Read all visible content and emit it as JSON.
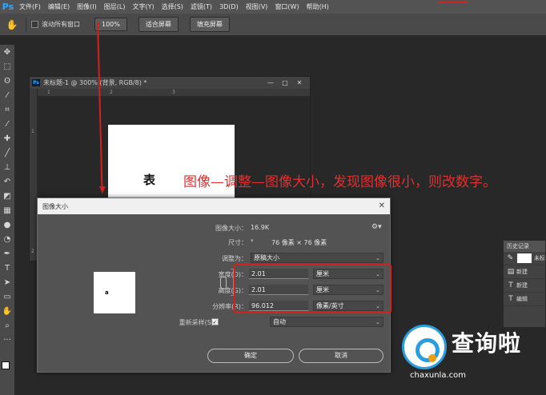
{
  "app": {
    "logo": "Ps"
  },
  "menubar": {
    "items": [
      "文件(F)",
      "编辑(E)",
      "图像(I)",
      "图层(L)",
      "文字(Y)",
      "选择(S)",
      "滤镜(T)",
      "3D(D)",
      "视图(V)",
      "窗口(W)",
      "帮助(H)"
    ]
  },
  "options_bar": {
    "tool_icon": "hand-icon",
    "scroll_all_label": "滚动所有窗口",
    "zoom_100_label": "100%",
    "fit_screen_label": "适合屏幕",
    "fill_screen_label": "填充屏幕"
  },
  "toolbar": {
    "tools": [
      "move-icon",
      "marquee-icon",
      "lasso-icon",
      "quick-select-icon",
      "crop-icon",
      "eyedropper-icon",
      "healing-icon",
      "brush-icon",
      "stamp-icon",
      "history-brush-icon",
      "eraser-icon",
      "gradient-icon",
      "blur-icon",
      "dodge-icon",
      "pen-icon",
      "type-icon",
      "path-select-icon",
      "rectangle-icon",
      "hand-icon",
      "zoom-icon",
      "more-icon"
    ]
  },
  "document": {
    "title": "未标题-1 @ 300% (背景, RGB/8) *",
    "ruler_h": [
      "1",
      "2",
      "3"
    ],
    "ruler_v": [
      "1",
      "2"
    ],
    "canvas_char": "表"
  },
  "annotation": {
    "text": "图像—调整—图像大小，发现图像很小，则改数字。",
    "color": "#e03030"
  },
  "dialog": {
    "title": "图像大小",
    "preview_char": "a",
    "image_size_label": "图像大小：",
    "image_size_value": "16.9K",
    "dimensions_label": "尺寸：",
    "dimensions_value": "76 像素 × 76 像素",
    "fit_label": "调整为：",
    "fit_value": "原稿大小",
    "width_label": "宽度(D)：",
    "width_value": "2.01",
    "width_unit": "厘米",
    "height_label": "高度(G)：",
    "height_value": "2.01",
    "height_unit": "厘米",
    "resolution_label": "分辨率(R)：",
    "resolution_value": "96.012",
    "resolution_unit": "像素/英寸",
    "resample_label": "重新采样(S)：",
    "resample_checked": true,
    "resample_value": "自动",
    "ok_label": "确定",
    "cancel_label": "取消"
  },
  "history_panel": {
    "tab": "历史记录",
    "rows": [
      {
        "icon": "thumbnail",
        "label": "未标"
      },
      {
        "icon": "layer-icon",
        "label": "新建"
      },
      {
        "icon": "type-icon",
        "label": "新建"
      },
      {
        "icon": "type-icon",
        "label": "编辑"
      }
    ]
  },
  "watermark": {
    "brand": "查询啦",
    "url": "chaxunla.com",
    "accent": "#2a9de0"
  }
}
